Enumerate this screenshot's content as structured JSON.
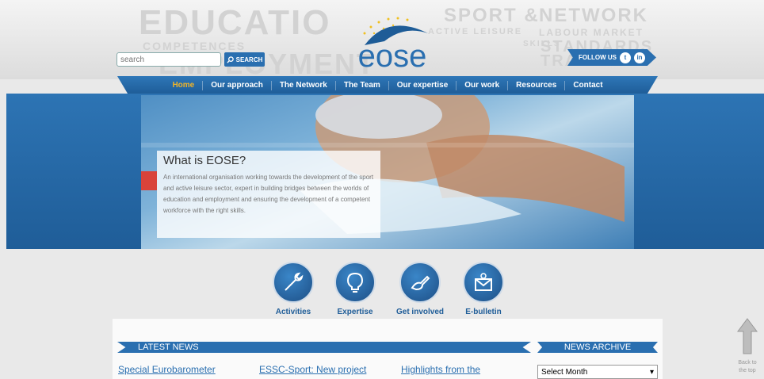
{
  "header": {
    "bg_words": [
      "EDUCATIO",
      "SPORT &",
      "NETWORK",
      "COMPETENCES",
      "ACTIVE LEISURE",
      "LABOUR MARKET",
      "EMPLOYMENT",
      "SKILLS",
      "STANDARDS",
      "TRA"
    ],
    "search_placeholder": "search",
    "search_button": "SEARCH",
    "logo_text": "eose",
    "follow_label": "FOLLOW US"
  },
  "nav": {
    "items": [
      "Home",
      "Our approach",
      "The Network",
      "The Team",
      "Our expertise",
      "Our work",
      "Resources",
      "Contact"
    ]
  },
  "hero": {
    "title": "What is EOSE?",
    "body": "An international organisation working towards the development of the sport and active leisure sector, expert in building bridges between the worlds of education and employment and ensuring the development of a competent workforce with the right skills."
  },
  "features": [
    {
      "label": "Activities",
      "icon": "wrench-icon"
    },
    {
      "label": "Expertise",
      "icon": "lightbulb-icon"
    },
    {
      "label": "Get involved",
      "icon": "pen-hand-icon"
    },
    {
      "label": "E-bulletin",
      "icon": "envelope-at-icon"
    }
  ],
  "news": {
    "latest_title": "LATEST NEWS",
    "archive_title": "NEWS ARCHIVE",
    "items": [
      "Special Eurobarometer",
      "ESSC-Sport: New project",
      "Highlights from the"
    ],
    "select_value": "Select Month"
  },
  "back_to_top": "Back to the top",
  "colors": {
    "brand_blue": "#2a6fb0",
    "nav_active": "#f0b429"
  }
}
